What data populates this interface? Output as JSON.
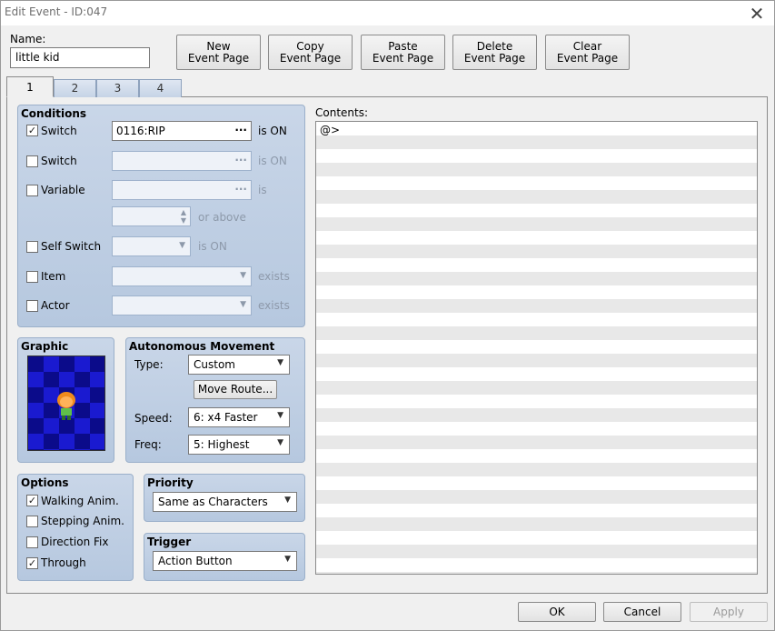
{
  "window": {
    "title": "Edit Event - ID:047",
    "close_glyph": "✕"
  },
  "name": {
    "label": "Name:",
    "value": "little kid"
  },
  "toolbar": {
    "new_page": [
      "New",
      "Event Page"
    ],
    "copy_page": [
      "Copy",
      "Event Page"
    ],
    "paste_page": [
      "Paste",
      "Event Page"
    ],
    "delete_page": [
      "Delete",
      "Event Page"
    ],
    "clear_page": [
      "Clear",
      "Event Page"
    ]
  },
  "tabs": [
    "1",
    "2",
    "3",
    "4"
  ],
  "conditions": {
    "title": "Conditions",
    "switch1": {
      "label": "Switch",
      "checked": true,
      "value": "0116:RIP",
      "suffix": "is ON"
    },
    "switch2": {
      "label": "Switch",
      "checked": false,
      "value": "",
      "suffix": "is ON"
    },
    "variable": {
      "label": "Variable",
      "checked": false,
      "value": "",
      "suffix": "is",
      "or_above": "or above"
    },
    "self_switch": {
      "label": "Self Switch",
      "checked": false,
      "suffix": "is ON"
    },
    "item": {
      "label": "Item",
      "checked": false,
      "suffix": "exists"
    },
    "actor": {
      "label": "Actor",
      "checked": false,
      "suffix": "exists"
    }
  },
  "graphic": {
    "title": "Graphic"
  },
  "autonomous": {
    "title": "Autonomous Movement",
    "type_label": "Type:",
    "type_value": "Custom",
    "move_route": "Move Route...",
    "speed_label": "Speed:",
    "speed_value": "6: x4 Faster",
    "freq_label": "Freq:",
    "freq_value": "5: Highest"
  },
  "options": {
    "title": "Options",
    "items": [
      {
        "label": "Walking Anim.",
        "checked": true
      },
      {
        "label": "Stepping Anim.",
        "checked": false
      },
      {
        "label": "Direction Fix",
        "checked": false
      },
      {
        "label": "Through",
        "checked": true
      }
    ]
  },
  "priority": {
    "title": "Priority",
    "value": "Same as Characters"
  },
  "trigger": {
    "title": "Trigger",
    "value": "Action Button"
  },
  "contents": {
    "label": "Contents:",
    "first_line": "@>"
  },
  "footer": {
    "ok": "OK",
    "cancel": "Cancel",
    "apply": "Apply"
  },
  "colors": {
    "group_bg": "#c0d0e4",
    "graphic_dark": "#0b0b8a",
    "graphic_light": "#1a1ad0"
  }
}
